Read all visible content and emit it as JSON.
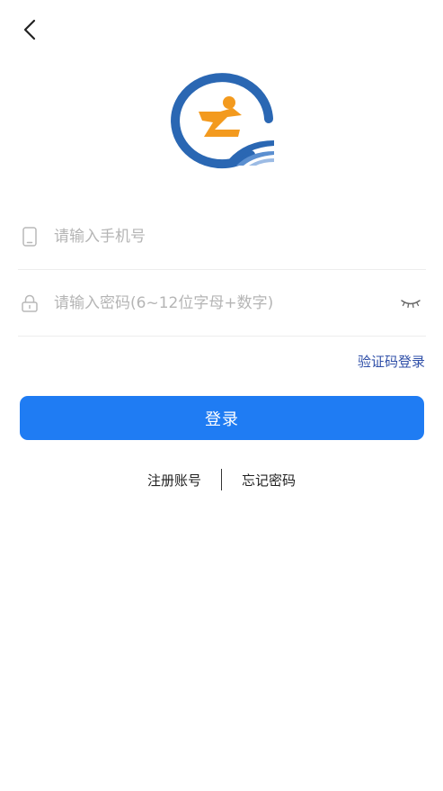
{
  "nav": {
    "back_icon": "chevron-left-icon"
  },
  "logo": {
    "icon": "runner-logo-icon",
    "colors": {
      "ring": "#2a67b3",
      "runner": "#f39a1e",
      "road": "#2a67b3"
    }
  },
  "form": {
    "phone": {
      "icon": "phone-icon",
      "placeholder": "请输入手机号",
      "value": ""
    },
    "password": {
      "icon": "lock-icon",
      "placeholder": "请输入密码(6~12位字母+数字)",
      "value": "",
      "toggle_icon": "eye-closed-icon"
    }
  },
  "sms_login_label": "验证码登录",
  "login_label": "登录",
  "links": {
    "register": "注册账号",
    "forgot": "忘记密码"
  },
  "colors": {
    "primary": "#1f7cf3",
    "link": "#2f4fa8",
    "placeholder": "#b5b5b5"
  }
}
